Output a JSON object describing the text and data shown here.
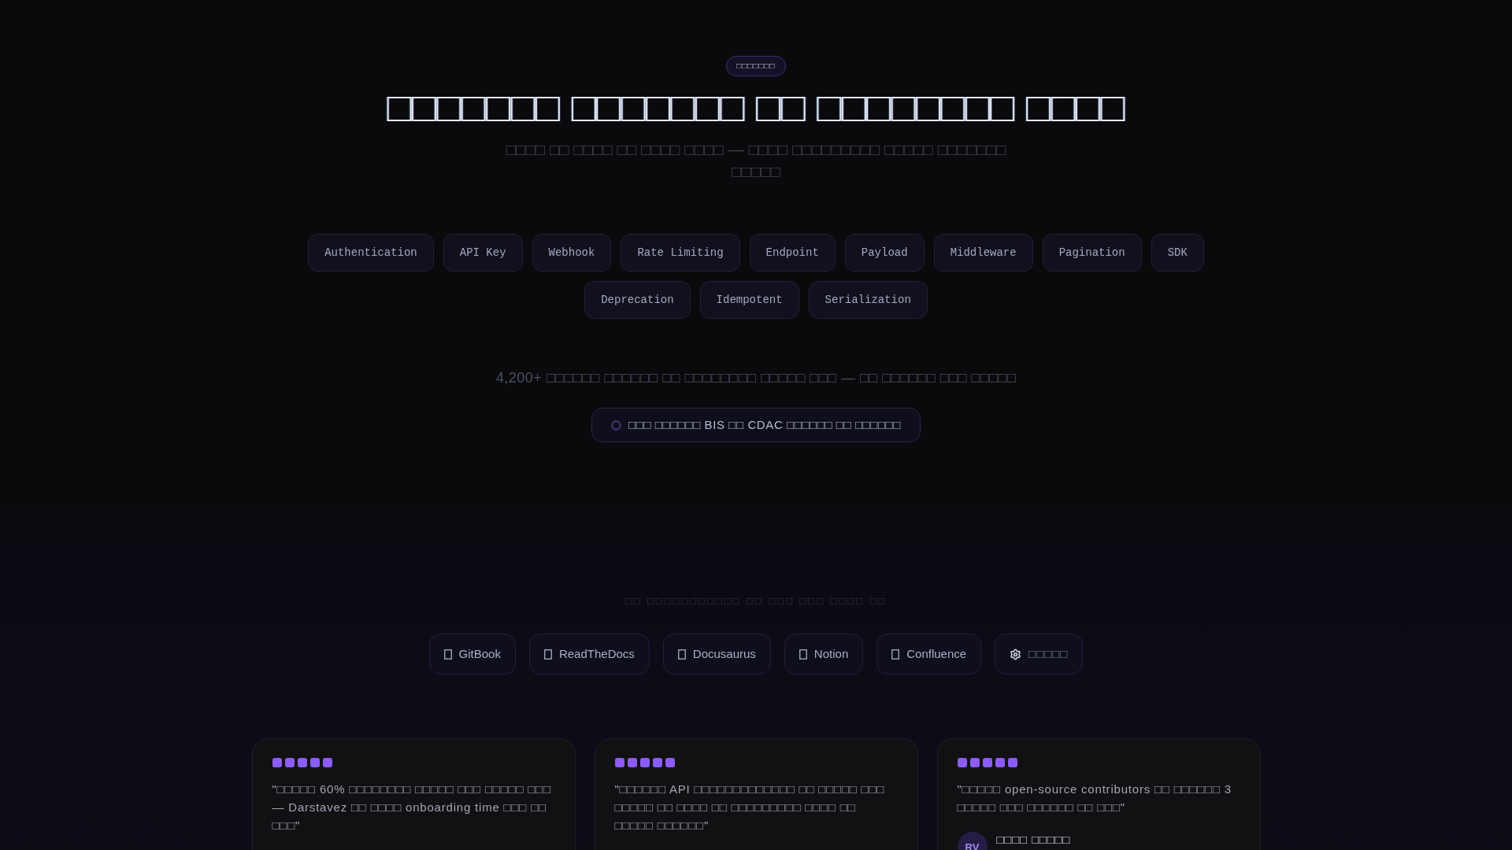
{
  "hero": {
    "badge": "□□□□□□□",
    "title": "□□□□□□□ □□□□□□□ □□ □□□□□□□□ □□□□",
    "subtitle": "□□□□ □□ □□□□ □□ □□□□ □□□□ — □□□□ □□□□□□□□□ □□□□□ □□□□□□□ □□□□□"
  },
  "tags": [
    "Authentication",
    "API Key",
    "Webhook",
    "Rate Limiting",
    "Endpoint",
    "Payload",
    "Middleware",
    "Pagination",
    "SDK",
    "Deprecation",
    "Idempotent",
    "Serialization"
  ],
  "stats": "4,200+ □□□□□□ □□□□□□ □□ □□□□□□□□ □□□□□ □□□ — □□ □□□□□□ □□□ □□□□□",
  "notice": {
    "text": "□□□ □□□□□□ BIS □□ CDAC □□□□□□ □□ □□□□□□"
  },
  "integrations": {
    "heading": "□□ □□□□□□□□□□□ □□ □□□ □□□ □□□□ □□",
    "items": [
      {
        "kind": "platform",
        "label": "GitBook"
      },
      {
        "kind": "platform",
        "label": "ReadTheDocs"
      },
      {
        "kind": "platform",
        "label": "Docusaurus"
      },
      {
        "kind": "platform",
        "label": "Notion"
      },
      {
        "kind": "platform",
        "label": "Confluence"
      },
      {
        "kind": "custom",
        "label": "□□□□□"
      }
    ]
  },
  "testimonials": [
    {
      "stars": 5,
      "quote": "\"□□□□□ 60% □□□□□□□□ □□□□□ □□□ □□□□□ □□□ — Darstavez □□ □□□□ onboarding time □□□ □□ □□□\""
    },
    {
      "stars": 5,
      "quote": "\"□□□□□□ API □□□□□□□□□□□□□ □□ □□□□□ □□□ □□□□□ □□ □□□□ □□ □□□□□□□□□ □□□□ □□ □□□□□ □□□□□□\""
    },
    {
      "stars": 5,
      "quote": "\"□□□□□ open-source contributors □□ □□□□□□ 3 □□□□□ □□□ □□□□□□ □□ □□□\"",
      "author": {
        "initials": "RV",
        "name": "□□□□ □□□□□"
      }
    }
  ]
}
